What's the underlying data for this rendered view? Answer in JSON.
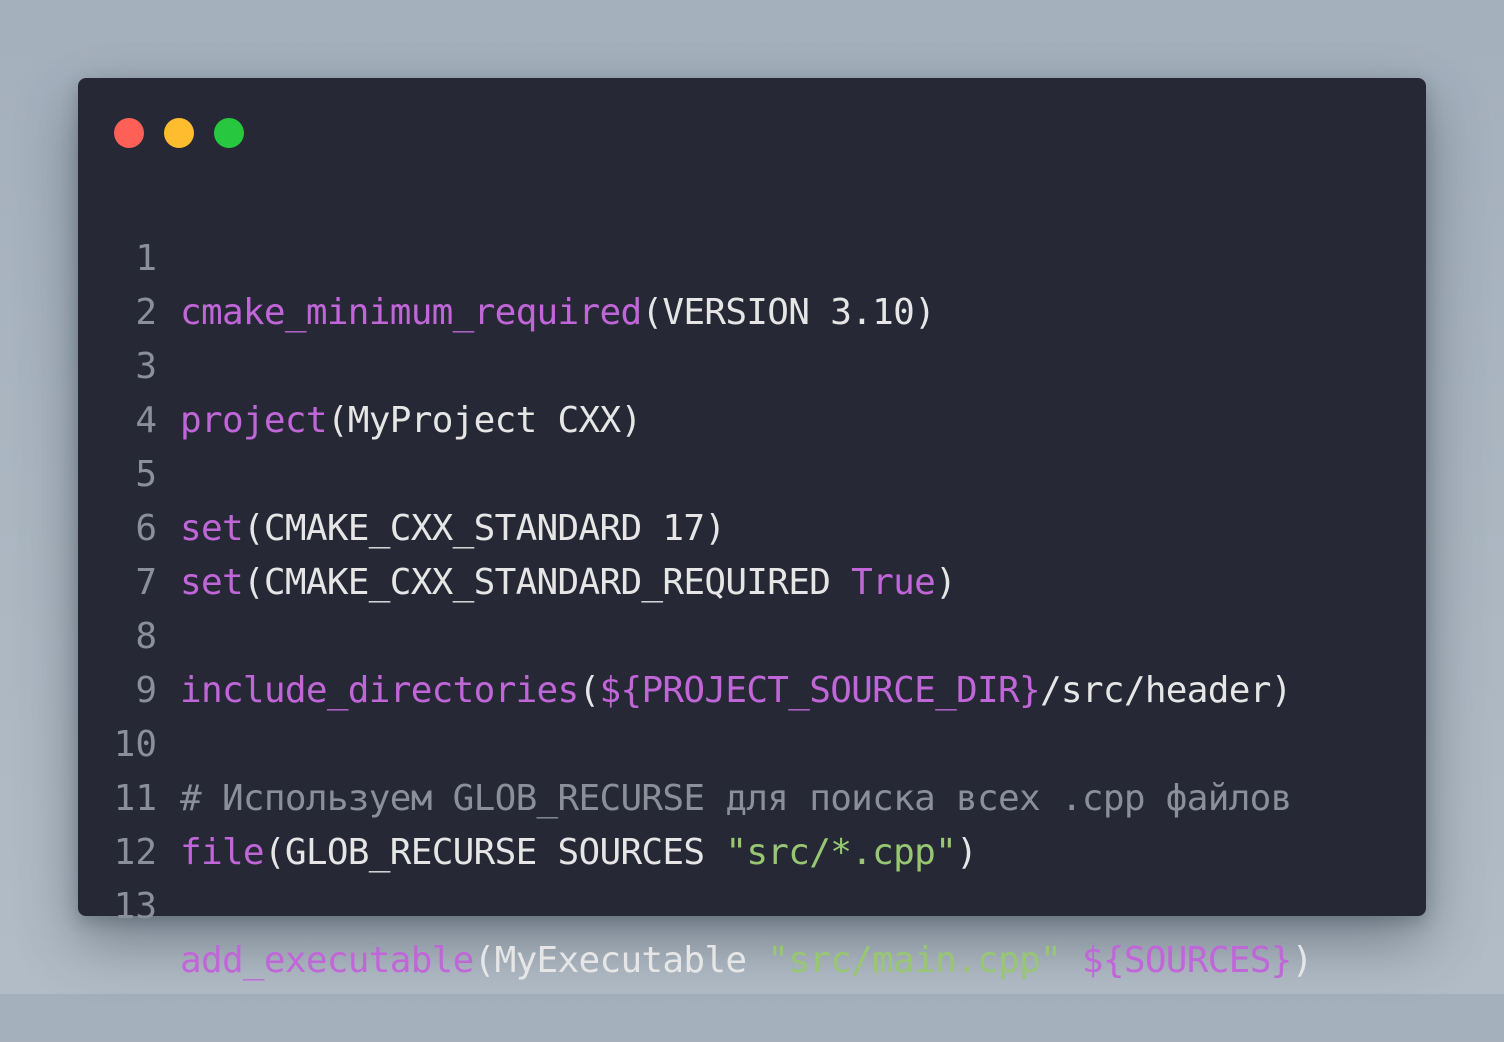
{
  "window": {
    "controls": {
      "close": "red-dot",
      "minimize": "yellow-dot",
      "maximize": "green-dot"
    }
  },
  "colors": {
    "keyword": "#c066d8",
    "plain": "#e6e6e6",
    "string": "#98c773",
    "comment": "#8a8f9a",
    "background": "#262935"
  },
  "lines": [
    {
      "number": "1",
      "tokens": [
        {
          "type": "kw",
          "text": "cmake_minimum_required"
        },
        {
          "type": "pl",
          "text": "(VERSION 3.10)"
        }
      ]
    },
    {
      "number": "2",
      "tokens": []
    },
    {
      "number": "3",
      "tokens": [
        {
          "type": "kw",
          "text": "project"
        },
        {
          "type": "pl",
          "text": "(MyProject CXX)"
        }
      ]
    },
    {
      "number": "4",
      "tokens": []
    },
    {
      "number": "5",
      "tokens": [
        {
          "type": "kw",
          "text": "set"
        },
        {
          "type": "pl",
          "text": "(CMAKE_CXX_STANDARD 17)"
        }
      ]
    },
    {
      "number": "6",
      "tokens": [
        {
          "type": "kw",
          "text": "set"
        },
        {
          "type": "pl",
          "text": "(CMAKE_CXX_STANDARD_REQUIRED "
        },
        {
          "type": "kw",
          "text": "True"
        },
        {
          "type": "pl",
          "text": ")"
        }
      ]
    },
    {
      "number": "7",
      "tokens": []
    },
    {
      "number": "8",
      "tokens": [
        {
          "type": "kw",
          "text": "include_directories"
        },
        {
          "type": "pl",
          "text": "("
        },
        {
          "type": "kw",
          "text": "${PROJECT_SOURCE_DIR}"
        },
        {
          "type": "pl",
          "text": "/src/header)"
        }
      ]
    },
    {
      "number": "9",
      "tokens": []
    },
    {
      "number": "10",
      "tokens": [
        {
          "type": "cm",
          "text": "# Используем GLOB_RECURSE для поиска всех .cpp файлов"
        }
      ]
    },
    {
      "number": "11",
      "tokens": [
        {
          "type": "kw",
          "text": "file"
        },
        {
          "type": "pl",
          "text": "(GLOB_RECURSE SOURCES "
        },
        {
          "type": "str",
          "text": "\"src/*.cpp\""
        },
        {
          "type": "pl",
          "text": ")"
        }
      ]
    },
    {
      "number": "12",
      "tokens": []
    },
    {
      "number": "13",
      "tokens": [
        {
          "type": "kw",
          "text": "add_executable"
        },
        {
          "type": "pl",
          "text": "(MyExecutable "
        },
        {
          "type": "str",
          "text": "\"src/main.cpp\""
        },
        {
          "type": "pl",
          "text": " "
        },
        {
          "type": "kw",
          "text": "${SOURCES}"
        },
        {
          "type": "pl",
          "text": ")"
        }
      ]
    }
  ]
}
